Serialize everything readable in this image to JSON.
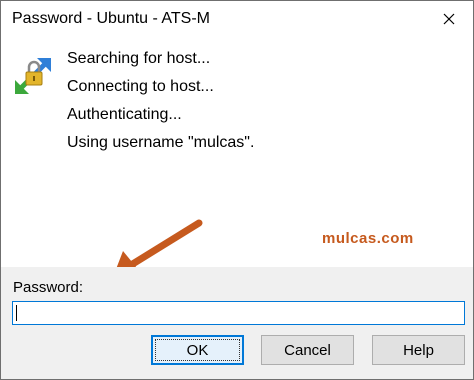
{
  "window": {
    "title": "Password - Ubuntu - ATS-M"
  },
  "messages": [
    "Searching for host...",
    "Connecting to host...",
    "Authenticating...",
    "Using username \"mulcas\"."
  ],
  "watermark": "mulcas.com",
  "password": {
    "label": "Password:",
    "value": ""
  },
  "buttons": {
    "ok": "OK",
    "cancel": "Cancel",
    "help": "Help"
  },
  "icons": {
    "close": "close-icon",
    "app": "putty-lock-connection-icon",
    "annotation": "arrow-annotation"
  },
  "colors": {
    "accent": "#0078d7",
    "watermark": "#c65a1e",
    "panel_bg": "#f0f0f0"
  }
}
